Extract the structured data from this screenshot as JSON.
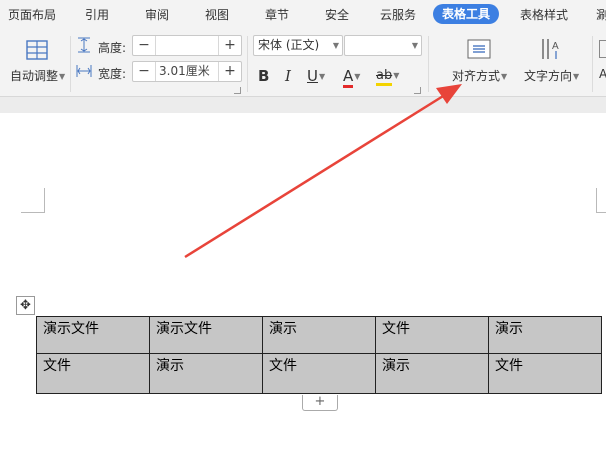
{
  "menubar": {
    "items": [
      "页面布局",
      "引用",
      "审阅",
      "视图",
      "章节",
      "安全",
      "云服务",
      "表格工具",
      "表格样式",
      "涮"
    ],
    "active": "表格工具"
  },
  "ribbon": {
    "autofit_label": "自动调整",
    "height_label": "高度:",
    "height_value": "",
    "width_label": "宽度:",
    "width_value": "3.01厘米",
    "font_name": "宋体 (正文)",
    "font_size": "",
    "bold": "B",
    "italic": "I",
    "underline": "U",
    "font_color": "A",
    "highlight": "ab",
    "align_label": "对齐方式",
    "text_direction_label": "文字方向",
    "cut_off_label": "A"
  },
  "table": {
    "rows": [
      [
        "演示文件",
        "演示文件",
        "演示",
        "文件",
        "演示"
      ],
      [
        "文件",
        "演示",
        "文件",
        "演示",
        "文件"
      ]
    ]
  },
  "colors": {
    "accent": "#3c7fe2",
    "annotation_arrow": "#e8443a",
    "cell_fill": "#c6c6c6"
  }
}
